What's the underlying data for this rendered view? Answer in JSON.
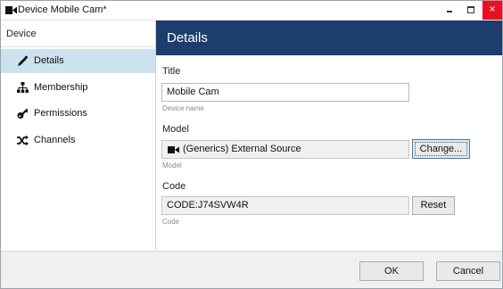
{
  "window": {
    "title": "Device Mobile Cam*",
    "controls": {
      "minimize": "–",
      "maximize": "□",
      "close": "×"
    }
  },
  "sidebar": {
    "header": "Device",
    "items": [
      {
        "label": "Details",
        "icon": "pencil-icon",
        "active": true
      },
      {
        "label": "Membership",
        "icon": "sitemap-icon",
        "active": false
      },
      {
        "label": "Permissions",
        "icon": "key-icon",
        "active": false
      },
      {
        "label": "Channels",
        "icon": "shuffle-icon",
        "active": false
      }
    ]
  },
  "main": {
    "header": "Details",
    "title_field": {
      "label": "Title",
      "value": "Mobile Cam",
      "hint": "Device name"
    },
    "model_field": {
      "label": "Model",
      "value": "(Generics) External Source",
      "hint": "Model",
      "button": "Change..."
    },
    "code_field": {
      "label": "Code",
      "value": "CODE:J74SVW4R",
      "hint": "Code",
      "button": "Reset"
    }
  },
  "footer": {
    "ok": "OK",
    "cancel": "Cancel"
  },
  "colors": {
    "header_bg": "#1c3d6e",
    "active_item_bg": "#cde2ef",
    "close_button": "#e81123"
  }
}
